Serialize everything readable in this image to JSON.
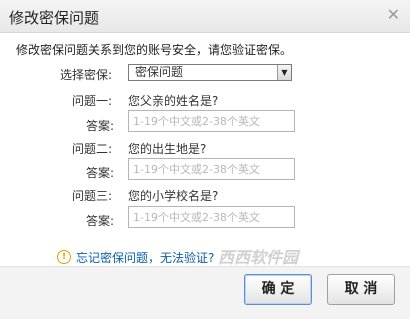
{
  "dialog": {
    "title": "修改密保问题",
    "intro": "修改密保问题关系到您的账号安全，请您验证密保。"
  },
  "form": {
    "select_label": "选择密保:",
    "select_value": "密保问题",
    "answer_label": "答案:",
    "answer_placeholder": "1-19个中文或2-38个英文",
    "questions": [
      {
        "label": "问题一:",
        "text": "您父亲的姓名是?"
      },
      {
        "label": "问题二:",
        "text": "您的出生地是?"
      },
      {
        "label": "问题三:",
        "text": "您的小学校名是?"
      }
    ]
  },
  "forgot": {
    "icon": "!",
    "text": "忘记密保问题，无法验证?"
  },
  "buttons": {
    "ok": "确 定",
    "cancel": "取 消"
  },
  "watermark": "西西软件园"
}
